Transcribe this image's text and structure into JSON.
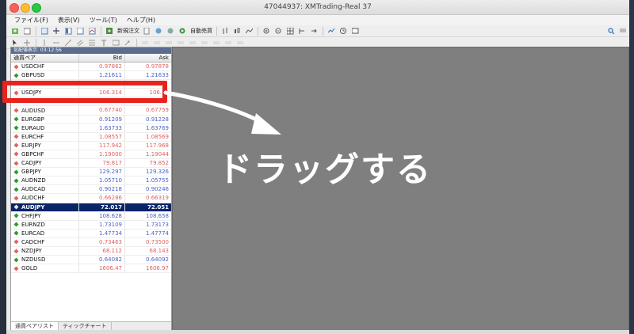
{
  "window": {
    "title": "47044937: XMTrading-Real 37"
  },
  "menu": [
    "ファイル(F)",
    "表示(V)",
    "ツール(T)",
    "ヘルプ(H)"
  ],
  "toolbar": {
    "new_order": "新規注文",
    "auto_trading": "自動売買"
  },
  "market_watch": {
    "caption": "気配値表示: 03:12:56",
    "headers": {
      "symbol": "通貨ペア",
      "bid": "Bid",
      "ask": "Ask"
    },
    "rows": [
      {
        "symbol": "USDCHF",
        "bid": "0.97862",
        "ask": "0.97878",
        "dir": "down"
      },
      {
        "symbol": "GBPUSD",
        "bid": "1.21611",
        "ask": "1.21633",
        "dir": "up"
      },
      {
        "symbol": "",
        "bid": "",
        "ask": "",
        "dir": "hidden"
      },
      {
        "symbol": "USDJPY",
        "bid": "106.314",
        "ask": "106.33",
        "dir": "down"
      },
      {
        "symbol": "",
        "bid": "",
        "ask": "",
        "dir": "hidden"
      },
      {
        "symbol": "AUDUSD",
        "bid": "0.67740",
        "ask": "0.67759",
        "dir": "down"
      },
      {
        "symbol": "EURGBP",
        "bid": "0.91209",
        "ask": "0.91228",
        "dir": "up"
      },
      {
        "symbol": "EURAUD",
        "bid": "1.63733",
        "ask": "1.63769",
        "dir": "up"
      },
      {
        "symbol": "EURCHF",
        "bid": "1.08557",
        "ask": "1.08569",
        "dir": "down"
      },
      {
        "symbol": "EURJPY",
        "bid": "117.942",
        "ask": "117.968",
        "dir": "down"
      },
      {
        "symbol": "GBPCHF",
        "bid": "1.19000",
        "ask": "1.19044",
        "dir": "down"
      },
      {
        "symbol": "CADJPY",
        "bid": "79.817",
        "ask": "79.852",
        "dir": "down"
      },
      {
        "symbol": "GBPJPY",
        "bid": "129.297",
        "ask": "129.326",
        "dir": "up"
      },
      {
        "symbol": "AUDNZD",
        "bid": "1.05710",
        "ask": "1.05755",
        "dir": "up"
      },
      {
        "symbol": "AUDCAD",
        "bid": "0.90218",
        "ask": "0.90246",
        "dir": "up"
      },
      {
        "symbol": "AUDCHF",
        "bid": "0.66286",
        "ask": "0.66319",
        "dir": "down"
      },
      {
        "symbol": "AUDJPY",
        "bid": "72.017",
        "ask": "72.051",
        "dir": "selected"
      },
      {
        "symbol": "CHFJPY",
        "bid": "108.628",
        "ask": "108.658",
        "dir": "up"
      },
      {
        "symbol": "EURNZD",
        "bid": "1.73109",
        "ask": "1.73173",
        "dir": "up"
      },
      {
        "symbol": "EURCAD",
        "bid": "1.47734",
        "ask": "1.47774",
        "dir": "up"
      },
      {
        "symbol": "CADCHF",
        "bid": "0.73463",
        "ask": "0.73500",
        "dir": "down"
      },
      {
        "symbol": "NZDJPY",
        "bid": "68.112",
        "ask": "68.143",
        "dir": "down"
      },
      {
        "symbol": "NZDUSD",
        "bid": "0.64082",
        "ask": "0.64092",
        "dir": "up"
      },
      {
        "symbol": "GOLD",
        "bid": "1606.47",
        "ask": "1606.97",
        "dir": "down"
      }
    ],
    "tabs": [
      "通貨ペアリスト",
      "ティックチャート"
    ]
  },
  "annotation": {
    "text": "ドラッグする"
  },
  "colors": {
    "up": "#4b61c9",
    "down": "#e06060",
    "selected": "#0a2468",
    "highlight": "#e8231d",
    "chart_bg": "#7f7f7f"
  }
}
